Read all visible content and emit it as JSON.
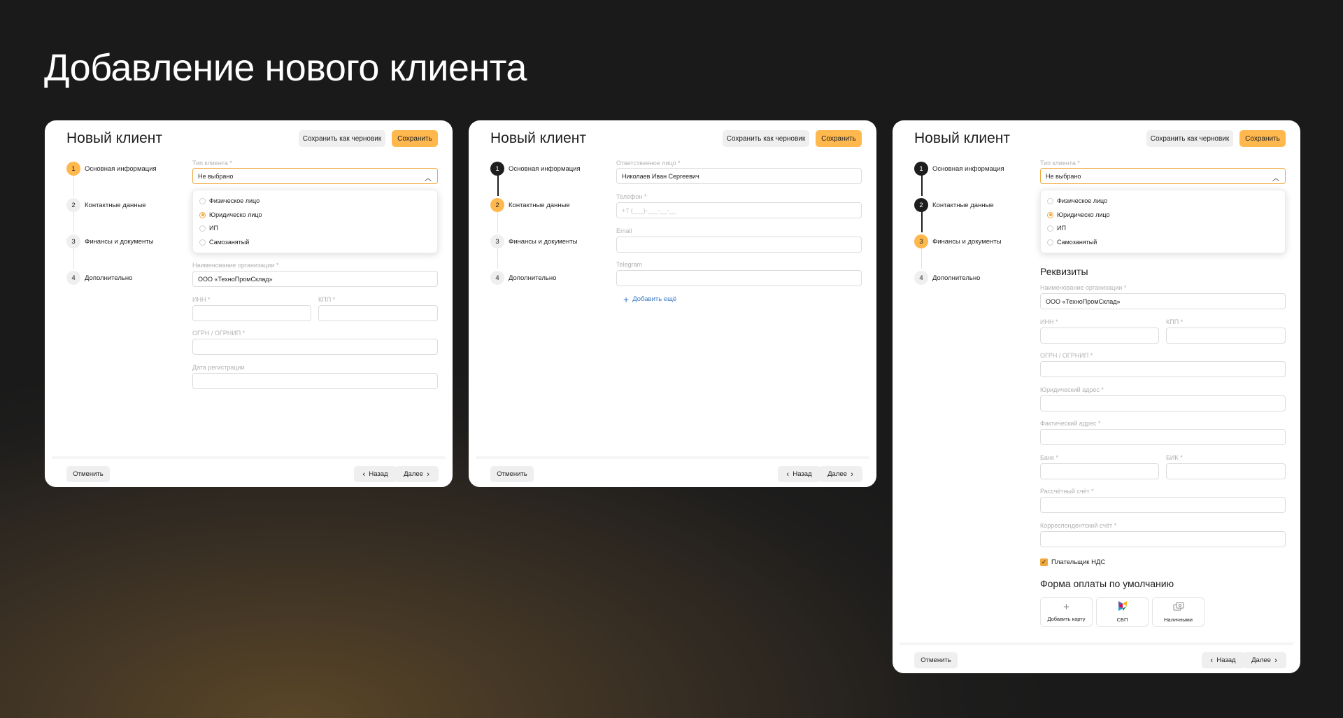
{
  "page_title": "Добавление нового клиента",
  "common": {
    "card_title": "Новый клиент",
    "draft_label": "Сохранить как черновик",
    "save_label": "Сохранить",
    "cancel_label": "Отменить",
    "back_label": "Назад",
    "next_label": "Далее",
    "steps": [
      {
        "num": "1",
        "label": "Основная информация"
      },
      {
        "num": "2",
        "label": "Контактные данные"
      },
      {
        "num": "3",
        "label": "Финансы и документы"
      },
      {
        "num": "4",
        "label": "Дополнительно"
      }
    ],
    "client_type_label": "Тип клиента *",
    "client_type_value": "Не выбрано",
    "client_type_options": [
      "Физическое лицо",
      "Юридическо лицо",
      "ИП",
      "Самозанятый"
    ],
    "org_name_label": "Наименование организации *",
    "org_name_value": "ООО «ТехноПромСклад»",
    "inn_label": "ИНН *",
    "kpp_label": "КПП *",
    "ogrn_label": "ОГРН / ОГРНИП *"
  },
  "card1": {
    "reg_date_label": "Дата регистрации"
  },
  "card2": {
    "responsible_label": "Ответственное лицо *",
    "responsible_value": "Николаев Иван Сергеевич",
    "phone_label": "Телефон *",
    "phone_placeholder": "+7 (___)-___-__-__",
    "email_label": "Email",
    "telegram_label": "Telegram",
    "add_more_label": "Добавить ещё"
  },
  "card3": {
    "requisites_title": "Реквизиты",
    "legal_address_label": "Юридический адрес *",
    "actual_address_label": "Фактический адрес *",
    "bank_label": "Банк *",
    "bik_label": "БИК *",
    "account_label": "Рассчётный счёт *",
    "corr_account_label": "Корреспондентский счёт *",
    "vat_label": "Плательщик НДС",
    "vat_checked": true,
    "payment_title": "Форма оплаты по умолчанию",
    "payment_options": [
      {
        "label": "Добавить карту",
        "icon": "plus-icon"
      },
      {
        "label": "СБП",
        "icon": "sbp-icon"
      },
      {
        "label": "Наличными",
        "icon": "cash-icon"
      }
    ]
  },
  "colors": {
    "accent": "#ffb84d",
    "accent_border": "#f0a93e",
    "done": "#1e1e1e",
    "link": "#3a78c2"
  }
}
